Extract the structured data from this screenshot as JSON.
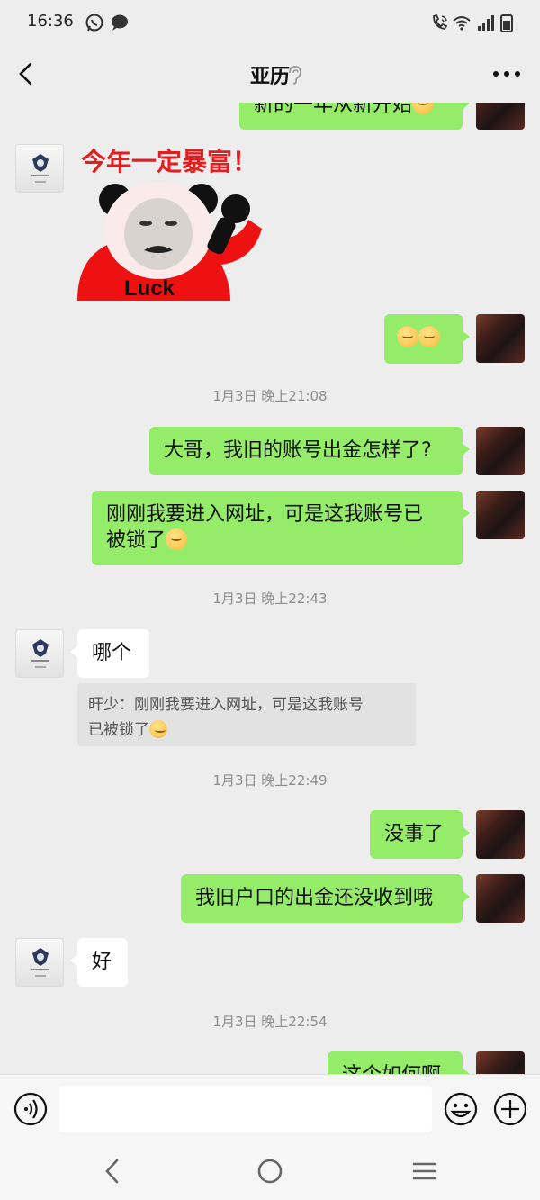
{
  "status_bar": {
    "time": "16:36"
  },
  "header": {
    "title": "亚历"
  },
  "messages": {
    "m0_text": "新的一年从新开始",
    "m1_sticker_caption": "今年一定暴富！",
    "m1_sticker_shirt": "Luck",
    "ts1": "1月3日 晚上21:08",
    "m3_text": "大哥，我旧的账号出金怎样了?",
    "m4_line1": "刚刚我要进入网址，可是这我账号已",
    "m4_line2": "被锁了",
    "ts2": "1月3日 晚上22:43",
    "m5_text": "哪个",
    "m5_quote_line1": "旰少：刚刚我要进入网址，可是这我账号",
    "m5_quote_line2": "已被锁了",
    "ts3": "1月3日 晚上22:49",
    "m6_text": "没事了",
    "m7_text": "我旧户口的出金还没收到哦",
    "m8_text": "好",
    "ts4": "1月3日 晚上22:54",
    "m9_text": "这个如何啊"
  },
  "icons": {
    "status": [
      "whatsapp-icon",
      "chat-icon",
      "wifi-call-icon",
      "wifi-icon",
      "signal-icon",
      "battery-icon"
    ],
    "header": [
      "back-icon",
      "ear-icon",
      "more-icon"
    ],
    "input": [
      "voice-icon",
      "emoji-icon",
      "plus-icon"
    ],
    "nav": [
      "nav-back-icon",
      "nav-home-icon",
      "nav-recents-icon"
    ]
  },
  "colors": {
    "my_bubble": "#95ec69",
    "their_bubble": "#ffffff",
    "background": "#ededed",
    "sticker_caption": "#e02020"
  }
}
